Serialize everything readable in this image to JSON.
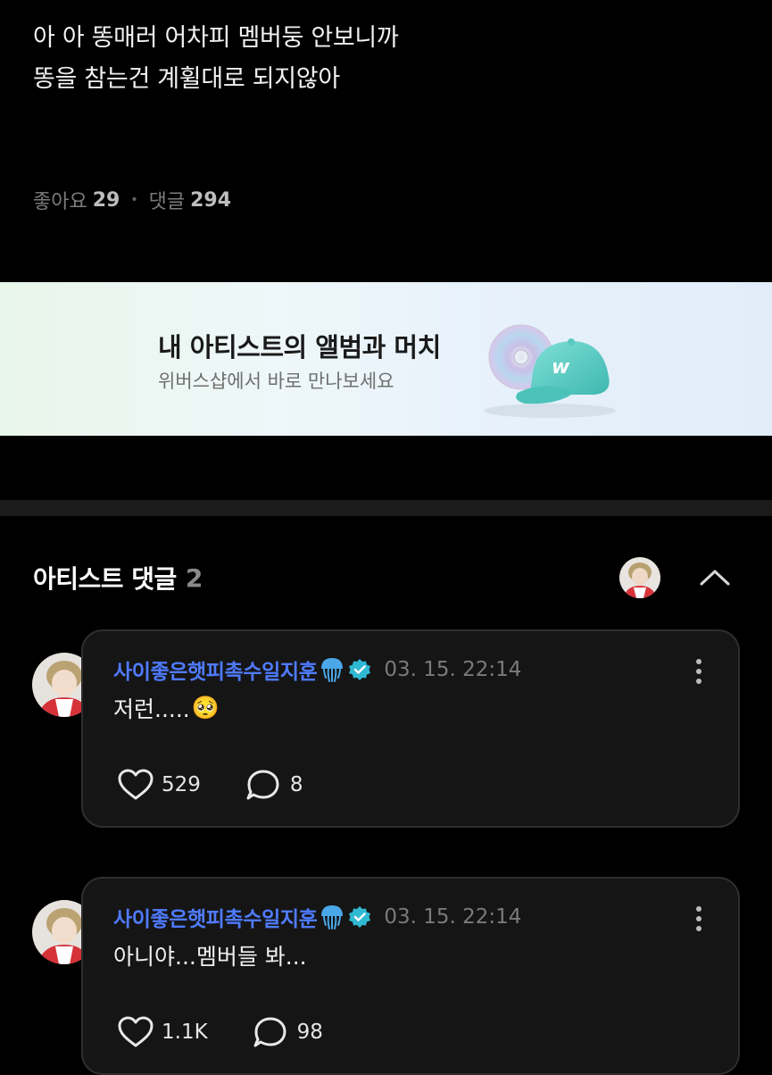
{
  "post": {
    "lines": [
      "아 아 똥매러 어차피 멤버둥 안보니까",
      "똥을 참는건 계휠대로 되지않아"
    ],
    "likes_label": "좋아요",
    "likes_count": "29",
    "separator": "•",
    "comments_label": "댓글",
    "comments_count": "294"
  },
  "banner": {
    "title": "내 아티스트의 앨범과 머치",
    "subtitle": "위버스샵에서 바로 만나보세요",
    "brand_letter": "w"
  },
  "artist_comments": {
    "title": "아티스트 댓글",
    "count": "2",
    "items": [
      {
        "author": "사이좋은햇피촉수일지훈",
        "date": "03. 15. 22:14",
        "text": "저런.....",
        "emoji": "🥺",
        "likes": "529",
        "replies": "8"
      },
      {
        "author": "사이좋은햇피촉수일지훈",
        "date": "03. 15. 22:14",
        "text": "아니야...멤버들 봐...",
        "likes": "1.1K",
        "replies": "98"
      }
    ]
  },
  "colors": {
    "background": "#000000",
    "author_name": "#4f7bff",
    "verified_badge": "#2fb9d3",
    "card_bg": "#151515",
    "banner_cap": "#5fd0c8"
  },
  "icons": [
    "jellyfish-icon",
    "verified-badge-icon",
    "more-vertical-icon",
    "heart-icon",
    "comment-bubble-icon",
    "chevron-up-icon"
  ]
}
